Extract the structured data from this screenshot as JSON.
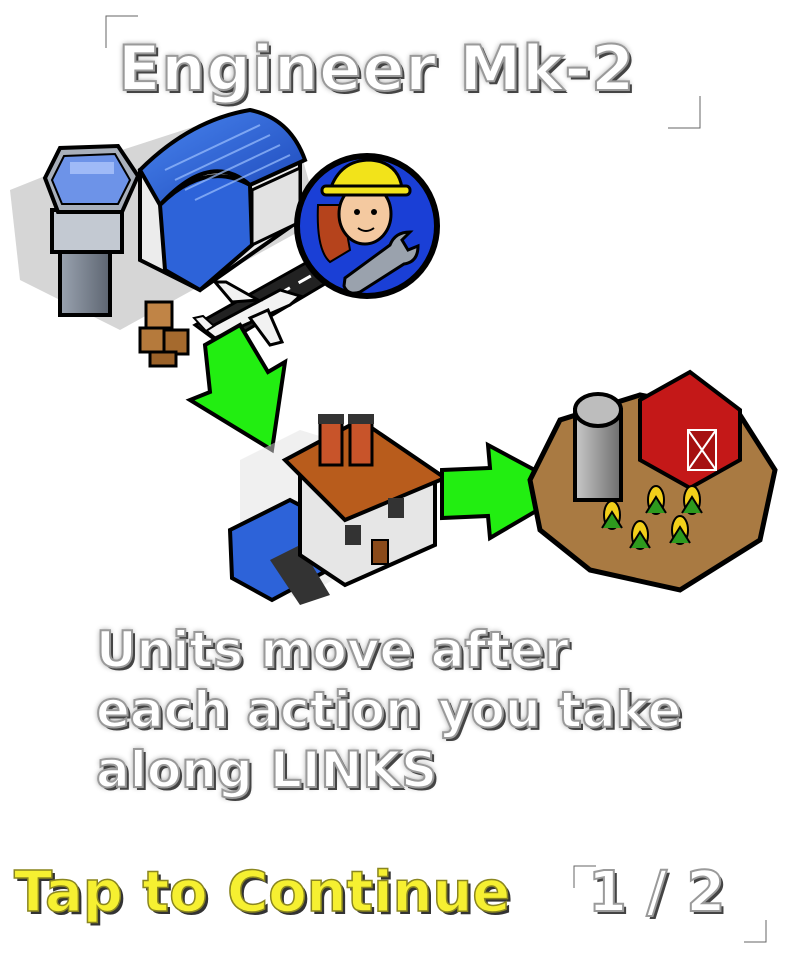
{
  "tutorial": {
    "title": "Engineer Mk-2",
    "lines": [
      "Units move after",
      "each action you take",
      "along LINKS"
    ],
    "continue_label": "Tap to Continue",
    "page_counter": "1 / 2"
  },
  "colors": {
    "continue_text": "#f6f031",
    "arrow_green": "#22ee11",
    "badge_blue": "#1a3fd6",
    "hangar_blue": "#2d63d9",
    "barn_red": "#c41818"
  },
  "icons": {
    "airport": "airport-icon",
    "engineer": "engineer-badge-icon",
    "factory": "factory-icon",
    "farm": "farm-icon",
    "arrow_down": "green-arrow-down-icon",
    "arrow_right": "green-arrow-right-icon"
  }
}
